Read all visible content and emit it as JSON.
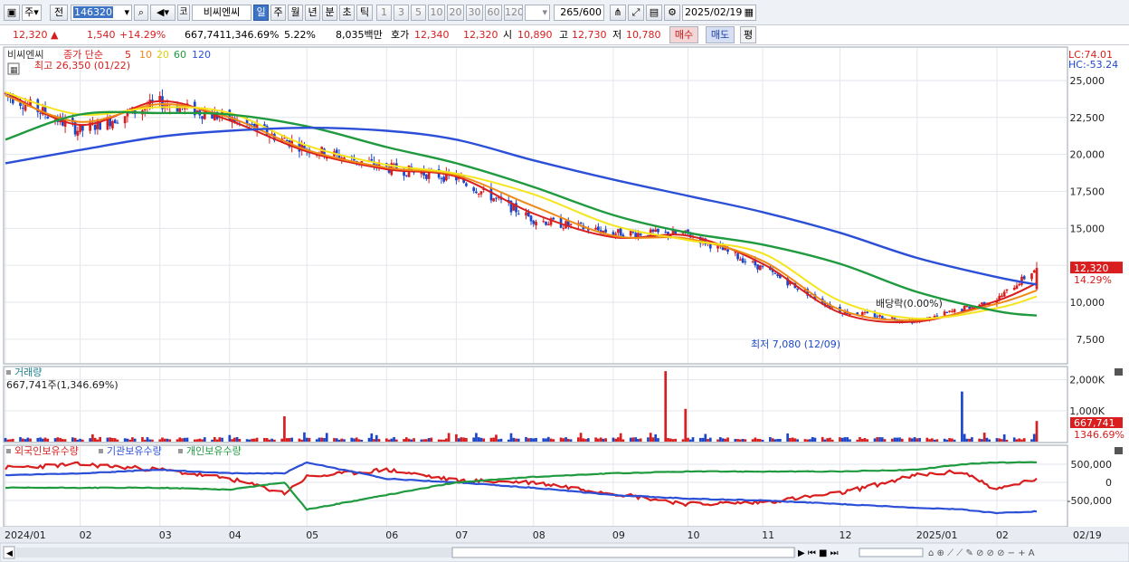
{
  "toolbar": {
    "period_mode": "주",
    "all_label": "전",
    "symbol_code": "146320",
    "market_tag": "코",
    "stock_name": "비씨엔씨",
    "periods": [
      "일",
      "주",
      "월",
      "년",
      "분",
      "초",
      "틱"
    ],
    "active_period": "일",
    "intervals": [
      "1",
      "3",
      "5",
      "10",
      "20",
      "30",
      "60",
      "120"
    ],
    "count": "265",
    "count_total": "/600",
    "date": "2025/02/19"
  },
  "infobar": {
    "price": "12,320",
    "arrow": "▲",
    "change": "1,540",
    "change_pct": "+14.29%",
    "volume": "667,741",
    "volume_pct": "1,346.69%",
    "turnover_pct": "5.22%",
    "amount": "8,035백만",
    "bid_label": "호가",
    "ask": "12,340",
    "bid": "12,320",
    "open_label": "시",
    "open": "10,890",
    "high_label": "고",
    "high": "12,730",
    "low_label": "저",
    "low": "10,780",
    "buy_label": "매수",
    "sell_label": "매도",
    "avg_label": "평"
  },
  "price_panel": {
    "name": "비씨엔씨",
    "ma_label": "종가 단순",
    "ma_periods": [
      "5",
      "10",
      "20",
      "60",
      "120"
    ],
    "ma_colors": [
      "#d81e1e",
      "#f08a16",
      "#f5e51c",
      "#1f9a3f",
      "#2c4fd8"
    ],
    "max_marker": "최고 26,350 (01/22)",
    "min_marker": "최저 7,080 (12/09)",
    "dividend_marker": "배당락(0.00%)",
    "lc_label": "LC:74.01",
    "hc_label": "HC:-53.24",
    "last_price_tag": "12,320",
    "last_pct_tag": "14.29%"
  },
  "volume_panel": {
    "title": "거래량",
    "value_label": "667,741주(1,346.69%)",
    "last_tag": "667,741",
    "last_pct_tag": "1346.69%"
  },
  "holdings_panel": {
    "legend": [
      "외국인보유수량",
      "기관보유수량",
      "개인보유수량"
    ],
    "colors": [
      "#d81e1e",
      "#2c4fd8",
      "#1f9a3f"
    ]
  },
  "x_axis_labels": [
    "2024/01",
    "02",
    "03",
    "04",
    "05",
    "06",
    "07",
    "08",
    "09",
    "10",
    "11",
    "12",
    "2025/01",
    "02"
  ],
  "x_axis_end_label": "02/19",
  "chart_data": [
    {
      "type": "line",
      "title": "",
      "ylim": [
        5900,
        27200
      ],
      "y_ticks": [
        7500,
        10000,
        12500,
        15000,
        17500,
        20000,
        22500,
        25000
      ],
      "y_tick_labels": [
        "7,500",
        "10,000",
        "12,500",
        "15,000",
        "17,500",
        "20,000",
        "22,500",
        "25,000"
      ],
      "x_anchors": {
        "dates": [
          "2024/01/02",
          "2024/02/01",
          "2024/03/04",
          "2024/04/01",
          "2024/05/02",
          "2024/06/03",
          "2024/07/01",
          "2024/08/01",
          "2024/09/02",
          "2024/10/02",
          "2024/11/01",
          "2024/12/02",
          "2025/01/02",
          "2025/02/03",
          "2025/02/19"
        ],
        "values": [
          24100,
          21600,
          23500,
          22400,
          20400,
          19100,
          18400,
          15600,
          14700,
          14600,
          12300,
          9400,
          8700,
          10200,
          12320
        ]
      },
      "ohlc_last": {
        "open": 10890,
        "high": 12730,
        "low": 10780,
        "close": 12320
      },
      "series": [
        {
          "name": "5",
          "values": [
            24200,
            22000,
            23600,
            22300,
            20200,
            19000,
            18500,
            16000,
            14400,
            14500,
            12600,
            9300,
            8700,
            10100,
            11300
          ]
        },
        {
          "name": "10",
          "values": [
            24000,
            22200,
            23400,
            22500,
            20300,
            19100,
            18600,
            16500,
            14500,
            14300,
            12800,
            9500,
            8800,
            9900,
            10800
          ]
        },
        {
          "name": "20",
          "values": [
            24200,
            22700,
            23200,
            22800,
            20600,
            19300,
            18700,
            17300,
            15200,
            14200,
            13300,
            10100,
            8900,
            9600,
            10400
          ]
        },
        {
          "name": "60",
          "values": [
            21000,
            22700,
            22800,
            22700,
            21900,
            20500,
            19400,
            17800,
            15900,
            14700,
            13900,
            12600,
            10700,
            9400,
            9100
          ]
        },
        {
          "name": "120",
          "values": [
            19400,
            20300,
            21200,
            21600,
            21800,
            21600,
            21000,
            19600,
            18300,
            17200,
            16100,
            14700,
            13000,
            11700,
            11200
          ]
        }
      ]
    },
    {
      "type": "bar",
      "title": "거래량",
      "ylim": [
        0,
        2400000
      ],
      "y_ticks": [
        1000000,
        2000000
      ],
      "y_tick_labels": [
        "1,000K",
        "2,000K"
      ],
      "spikes": [
        {
          "date": "2024/04/23",
          "value": 820000
        },
        {
          "date": "2024/09/23",
          "value": 2280000
        },
        {
          "date": "2024/10/01",
          "value": 1060000
        },
        {
          "date": "2025/01/20",
          "value": 1620000
        },
        {
          "date": "2025/02/19",
          "value": 667741
        }
      ]
    },
    {
      "type": "line",
      "title": "",
      "ylim": [
        -1200000,
        1000000
      ],
      "y_ticks": [
        500000,
        0,
        -500000
      ],
      "y_tick_labels": [
        "500,000",
        "0",
        "-500,000"
      ],
      "x_anchors": [
        "2024/01/02",
        "2024/02/01",
        "2024/03/04",
        "2024/04/01",
        "2024/04/23",
        "2024/05/02",
        "2024/06/03",
        "2024/07/01",
        "2024/08/01",
        "2024/09/02",
        "2024/10/02",
        "2024/11/01",
        "2024/12/02",
        "2025/01/02",
        "2025/01/20",
        "2025/02/03",
        "2025/02/19"
      ],
      "series": [
        {
          "name": "외국인보유수량",
          "values": [
            400000,
            500000,
            350000,
            100000,
            -300000,
            150000,
            350000,
            50000,
            0,
            -300000,
            -600000,
            -550000,
            -300000,
            200000,
            300000,
            -200000,
            100000
          ]
        },
        {
          "name": "기관보유수량",
          "values": [
            200000,
            250000,
            350000,
            250000,
            250000,
            550000,
            100000,
            0,
            -150000,
            -350000,
            -450000,
            -500000,
            -600000,
            -700000,
            -750000,
            -850000,
            -800000
          ]
        },
        {
          "name": "개인보유수량",
          "values": [
            -150000,
            -150000,
            -150000,
            -200000,
            0,
            -750000,
            -350000,
            0,
            150000,
            250000,
            300000,
            300000,
            300000,
            350000,
            500000,
            550000,
            550000
          ]
        }
      ]
    }
  ]
}
